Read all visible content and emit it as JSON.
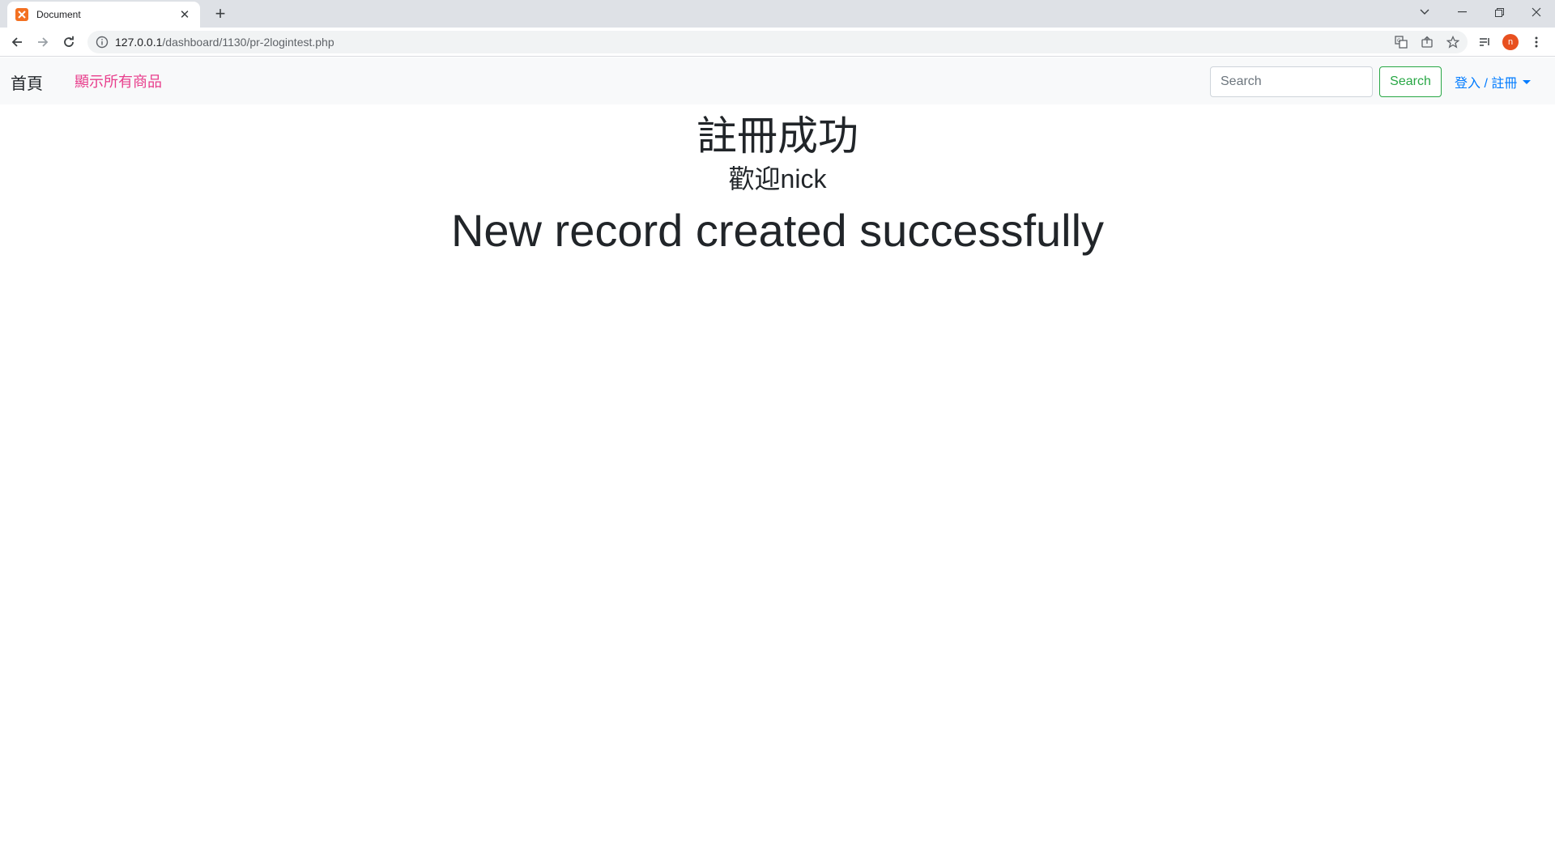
{
  "browser": {
    "tab_title": "Document",
    "url_host": "127.0.0.1",
    "url_path": "/dashboard/1130/pr-2logintest.php",
    "profile_initial": "n"
  },
  "navbar": {
    "home": "首頁",
    "all_products": "顯示所有商品",
    "search_placeholder": "Search",
    "search_button": "Search",
    "login_register": "登入 / 註冊"
  },
  "content": {
    "title": "註冊成功",
    "welcome": "歡迎nick",
    "message": "New record created successfully"
  },
  "colors": {
    "link_pink": "#e83e8c",
    "success_green": "#28a745",
    "primary_blue": "#007bff",
    "profile_orange": "#e8501f"
  }
}
